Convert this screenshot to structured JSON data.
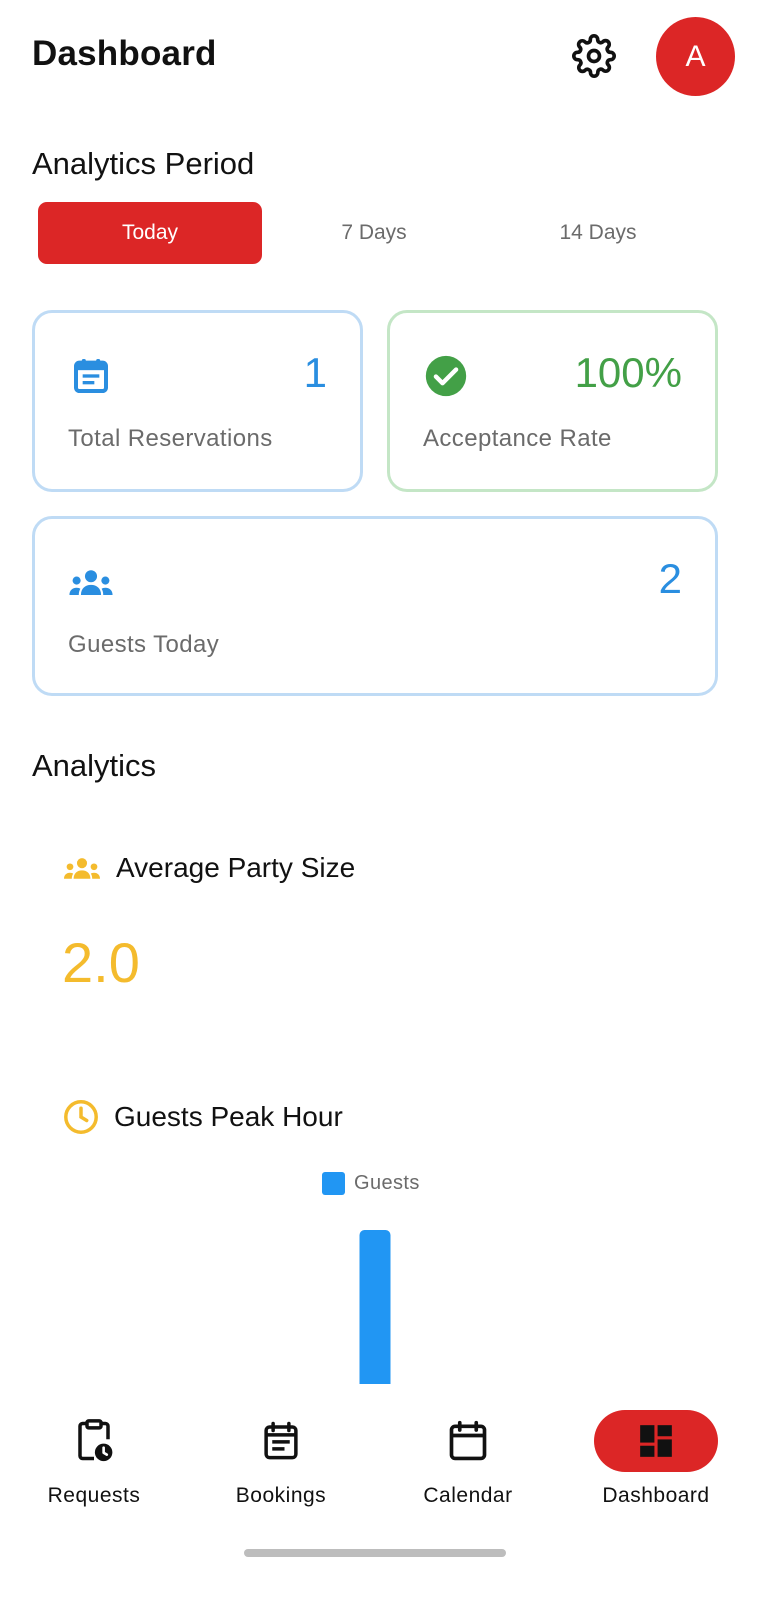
{
  "header": {
    "title": "Dashboard",
    "avatar_initial": "A"
  },
  "period": {
    "title": "Analytics Period",
    "tabs": [
      {
        "label": "Today",
        "active": true
      },
      {
        "label": "7 Days",
        "active": false
      },
      {
        "label": "14 Days",
        "active": false
      }
    ]
  },
  "stats": {
    "total_reservations": {
      "value": "1",
      "label": "Total Reservations",
      "icon": "calendar-list-icon"
    },
    "acceptance_rate": {
      "value": "100%",
      "label": "Acceptance Rate",
      "icon": "check-circle-icon"
    },
    "guests_today": {
      "value": "2",
      "label": "Guests Today",
      "icon": "people-group-icon"
    }
  },
  "analytics": {
    "title": "Analytics",
    "average_party_size": {
      "title": "Average Party Size",
      "value": "2.0",
      "icon": "people-group-icon"
    },
    "peak_hour": {
      "title": "Guests Peak Hour",
      "icon": "clock-icon"
    }
  },
  "chart_data": {
    "type": "bar",
    "series": [
      {
        "name": "Guests",
        "values": [
          2
        ]
      }
    ],
    "categories": [
      ""
    ],
    "legend": "top-center",
    "colors": {
      "Guests": "#2196f3"
    },
    "grid": false
  },
  "bottom_nav": {
    "items": [
      {
        "label": "Requests",
        "icon": "clipboard-clock-icon",
        "active": false
      },
      {
        "label": "Bookings",
        "icon": "bookings-list-icon",
        "active": false
      },
      {
        "label": "Calendar",
        "icon": "calendar-icon",
        "active": false
      },
      {
        "label": "Dashboard",
        "icon": "dashboard-grid-icon",
        "active": true
      }
    ]
  },
  "colors": {
    "accent": "#dc2626",
    "blue": "#2a8ee0",
    "green": "#43a047",
    "amber": "#f4bb2d"
  }
}
